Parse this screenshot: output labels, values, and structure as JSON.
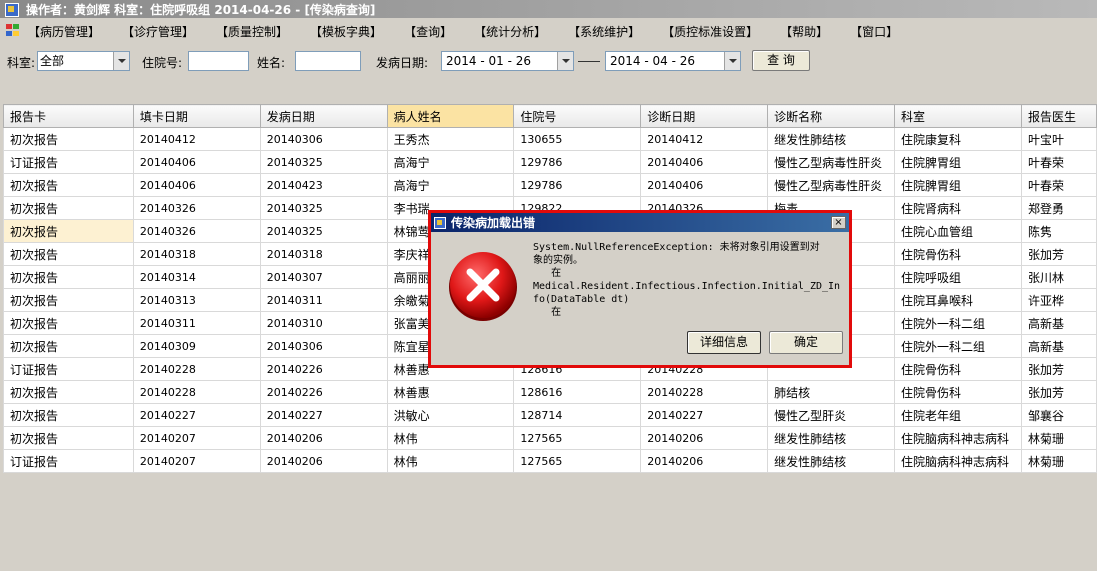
{
  "window": {
    "title": "操作者：黄剑辉   科室：住院呼吸组   2014-04-26 - [传染病查询]"
  },
  "menu": [
    "【病历管理】",
    "【诊疗管理】",
    "【质量控制】",
    "【模板字典】",
    "【查询】",
    "【统计分析】",
    "【系统维护】",
    "【质控标准设置】",
    "【帮助】",
    "【窗口】"
  ],
  "filter": {
    "dept_label": "科室:",
    "dept_value": "全部",
    "hosp_label": "住院号:",
    "hosp_value": "",
    "name_label": "姓名:",
    "name_value": "",
    "date_label": "发病日期:",
    "date_from": "2014 - 01 - 26",
    "date_to": "2014 - 04 - 26",
    "query_button": "查 询"
  },
  "table": {
    "columns": [
      "报告卡",
      "填卡日期",
      "发病日期",
      "病人姓名",
      "住院号",
      "诊断日期",
      "诊断名称",
      "科室",
      "报告医生"
    ],
    "rows": [
      [
        "初次报告",
        "20140412",
        "20140306",
        "王秀杰",
        "130655",
        "20140412",
        "继发性肺结核",
        "住院康复科",
        "叶宝叶"
      ],
      [
        "订证报告",
        "20140406",
        "20140325",
        "高海宁",
        "129786",
        "20140406",
        "慢性乙型病毒性肝炎",
        "住院脾胃组",
        "叶春荣"
      ],
      [
        "初次报告",
        "20140406",
        "20140423",
        "高海宁",
        "129786",
        "20140406",
        "慢性乙型病毒性肝炎",
        "住院脾胃组",
        "叶春荣"
      ],
      [
        "初次报告",
        "20140326",
        "20140325",
        "李书瑞",
        "129822",
        "20140326",
        "梅毒",
        "住院肾病科",
        "郑登勇"
      ],
      [
        "初次报告",
        "20140326",
        "20140325",
        "林锦莺",
        "",
        "",
        "",
        "住院心血管组",
        "陈隽"
      ],
      [
        "初次报告",
        "20140318",
        "20140318",
        "李庆祥",
        "",
        "",
        "",
        "住院骨伤科",
        "张加芳"
      ],
      [
        "初次报告",
        "20140314",
        "20140307",
        "高丽丽",
        "",
        "",
        "",
        "住院呼吸组",
        "张川林"
      ],
      [
        "初次报告",
        "20140313",
        "20140311",
        "余皦菊",
        "",
        "",
        "",
        "住院耳鼻喉科",
        "许亚桦"
      ],
      [
        "初次报告",
        "20140311",
        "20140310",
        "张富美",
        "",
        "",
        "",
        "住院外一科二组",
        "高新基"
      ],
      [
        "初次报告",
        "20140309",
        "20140306",
        "陈宜星",
        "",
        "",
        "",
        "住院外一科二组",
        "高新基"
      ],
      [
        "订证报告",
        "20140228",
        "20140226",
        "林善惠",
        "128616",
        "20140228",
        "",
        "住院骨伤科",
        "张加芳"
      ],
      [
        "初次报告",
        "20140228",
        "20140226",
        "林善惠",
        "128616",
        "20140228",
        "肺结核",
        "住院骨伤科",
        "张加芳"
      ],
      [
        "初次报告",
        "20140227",
        "20140227",
        "洪敏心",
        "128714",
        "20140227",
        "慢性乙型肝炎",
        "住院老年组",
        "邹襄谷"
      ],
      [
        "初次报告",
        "20140207",
        "20140206",
        "林伟",
        "127565",
        "20140206",
        "继发性肺结核",
        "住院脑病科神志病科",
        "林菊珊"
      ],
      [
        "订证报告",
        "20140207",
        "20140206",
        "林伟",
        "127565",
        "20140206",
        "继发性肺结核",
        "住院脑病科神志病科",
        "林菊珊"
      ]
    ]
  },
  "dialog": {
    "title": "传染病加载出错",
    "message": "System.NullReferenceException: 未将对象引用设置到对\n象的实例。\n   在\nMedical.Resident.Infectious.Infection.Initial_ZD_In\nfo(DataTable dt)\n   在",
    "details_button": "详细信息",
    "ok_button": "确定",
    "close_glyph": "×",
    "border_color": "#e20a0a"
  }
}
